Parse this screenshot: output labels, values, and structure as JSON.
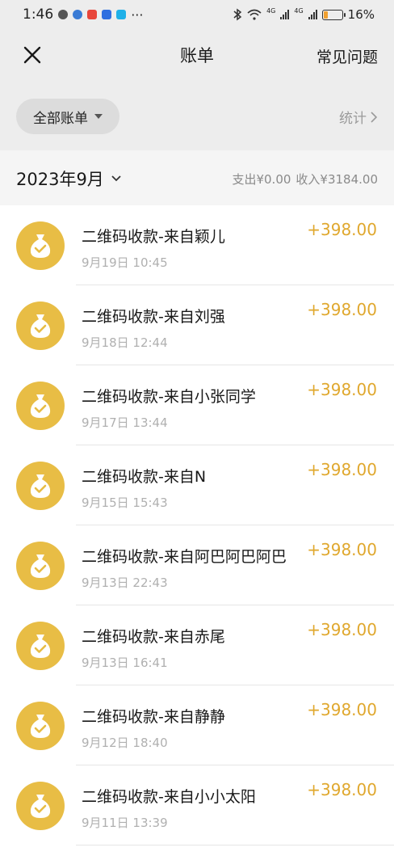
{
  "status_bar": {
    "time": "1:46",
    "more": "···",
    "network_1": "4G",
    "network_2": "4G",
    "battery": "16%"
  },
  "nav": {
    "title": "账单",
    "right_link": "常见问题"
  },
  "filter": {
    "chip_label": "全部账单",
    "stats_label": "统计"
  },
  "month": {
    "label": "2023年9月",
    "expense": "支出¥0.00",
    "income": "收入¥3184.00"
  },
  "colors": {
    "accent": "#e0a82e",
    "icon_bg": "#e8bd45"
  },
  "transactions": [
    {
      "title": "二维码收款-来自颖儿",
      "time": "9月19日 10:45",
      "amount": "+398.00"
    },
    {
      "title": "二维码收款-来自刘强",
      "time": "9月18日 12:44",
      "amount": "+398.00"
    },
    {
      "title": "二维码收款-来自小张同学",
      "time": "9月17日 13:44",
      "amount": "+398.00"
    },
    {
      "title": "二维码收款-来自N",
      "time": "9月15日 15:43",
      "amount": "+398.00"
    },
    {
      "title": "二维码收款-来自阿巴阿巴阿巴",
      "time": "9月13日 22:43",
      "amount": "+398.00"
    },
    {
      "title": "二维码收款-来自赤尾",
      "time": "9月13日 16:41",
      "amount": "+398.00"
    },
    {
      "title": "二维码收款-来自静静",
      "time": "9月12日 18:40",
      "amount": "+398.00"
    },
    {
      "title": "二维码收款-来自小小太阳",
      "time": "9月11日 13:39",
      "amount": "+398.00"
    }
  ]
}
